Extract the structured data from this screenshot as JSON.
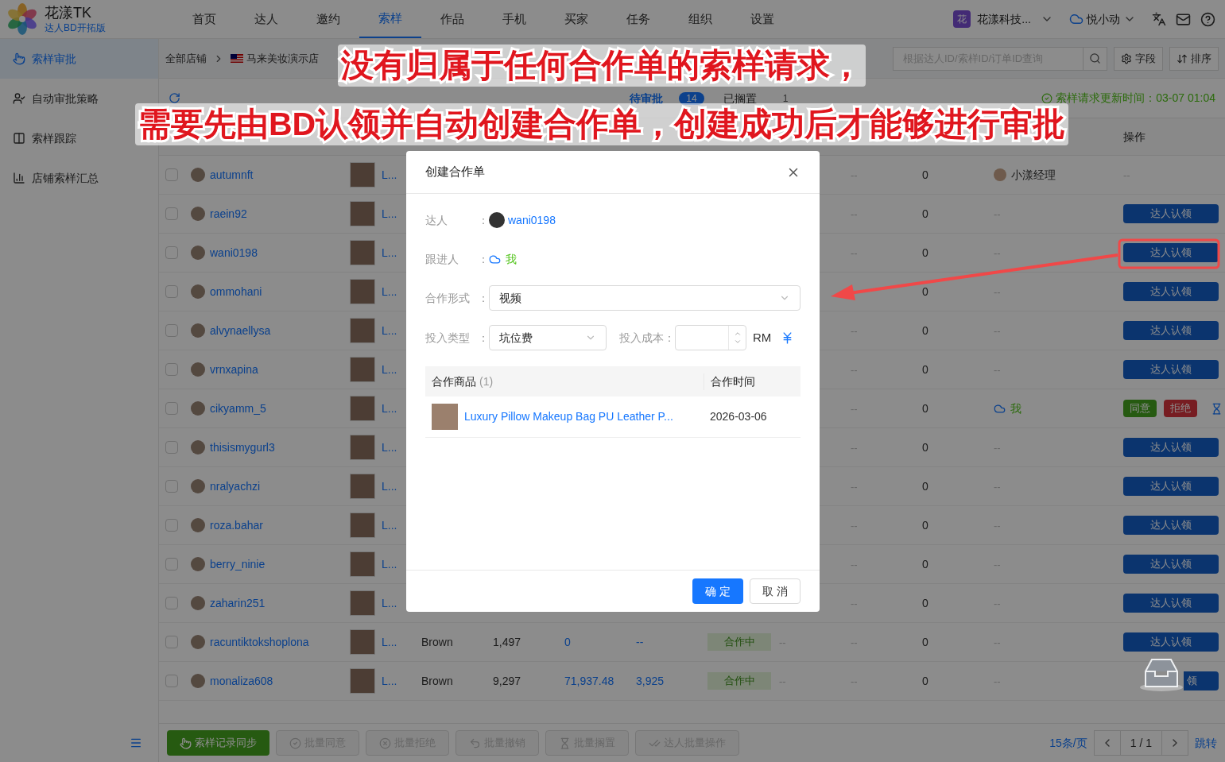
{
  "app": {
    "name": "花漾TK",
    "edition": "达人BD开拓版"
  },
  "nav": [
    {
      "label": "首页",
      "selected": false
    },
    {
      "label": "达人",
      "selected": false
    },
    {
      "label": "邀约",
      "selected": false
    },
    {
      "label": "索样",
      "selected": true
    },
    {
      "label": "作品",
      "selected": false
    },
    {
      "label": "手机",
      "selected": false
    },
    {
      "label": "买家",
      "selected": false
    },
    {
      "label": "任务",
      "selected": false
    },
    {
      "label": "组织",
      "selected": false
    },
    {
      "label": "设置",
      "selected": false
    }
  ],
  "account": {
    "org_badge": "花",
    "org": "花漾科技...",
    "user": "悦小动"
  },
  "sidebar": [
    {
      "label": "索样审批",
      "selected": true,
      "kind": "hand"
    },
    {
      "label": "自动审批策略",
      "selected": false,
      "kind": "person"
    },
    {
      "label": "索样跟踪",
      "selected": false,
      "kind": "board"
    },
    {
      "label": "店铺索样汇总",
      "selected": false,
      "kind": "chart"
    }
  ],
  "breadcrumb": {
    "root": "全部店铺",
    "store": "马来美妆演示店"
  },
  "search": {
    "placeholder": "根据达人ID/索样ID/订单ID查询"
  },
  "toolbar": [
    {
      "kind": "fields",
      "label": "字段"
    },
    {
      "kind": "sort",
      "label": "排序"
    }
  ],
  "tabs": [
    {
      "label": "待审批",
      "count": "14",
      "selected": true
    },
    {
      "label": "已搁置",
      "count": "1",
      "selected": false
    }
  ],
  "updated": "索样请求更新时间：03-07 01:04",
  "table": {
    "action_header": "操作",
    "rows": [
      {
        "checked": false,
        "creator": "autumnft",
        "product": "L...",
        "col_a": "--",
        "col_b": "0",
        "follower": {
          "kind": "user",
          "text": "小漾经理"
        },
        "action": {
          "kind": "none",
          "text": "--"
        }
      },
      {
        "checked": false,
        "creator": "raein92",
        "product": "L...",
        "col_a": "--",
        "col_b": "0",
        "follower": {
          "kind": "none",
          "text": "--"
        },
        "action": {
          "kind": "claim",
          "text": "达人认领"
        }
      },
      {
        "checked": false,
        "creator": "wani0198",
        "product": "L...",
        "col_a": "--",
        "col_b": "0",
        "follower": {
          "kind": "none",
          "text": "--"
        },
        "action": {
          "kind": "claim",
          "text": "达人认领"
        }
      },
      {
        "checked": false,
        "creator": "ommohani",
        "product": "L...",
        "col_b": "0",
        "follower": {
          "kind": "none",
          "text": "--"
        },
        "action": {
          "kind": "claim",
          "text": "达人认领"
        }
      },
      {
        "checked": false,
        "creator": "alvynaellysa",
        "product": "L...",
        "col_a": "--",
        "col_b": "0",
        "follower": {
          "kind": "none",
          "text": "--"
        },
        "action": {
          "kind": "claim",
          "text": "达人认领"
        }
      },
      {
        "checked": false,
        "creator": "vrnxapina",
        "product": "L...",
        "col_a": "--",
        "col_b": "0",
        "follower": {
          "kind": "none",
          "text": "--"
        },
        "action": {
          "kind": "claim",
          "text": "达人认领"
        }
      },
      {
        "checked": false,
        "creator": "cikyamm_5",
        "product": "L...",
        "col_a": "--",
        "col_b": "0",
        "follower": {
          "kind": "self",
          "text": "我"
        },
        "action": {
          "kind": "decide",
          "agree": "同意",
          "reject": "拒绝"
        }
      },
      {
        "checked": false,
        "creator": "thisismygurl3",
        "product": "L...",
        "col_a": "--",
        "col_b": "0",
        "follower": {
          "kind": "none",
          "text": "--"
        },
        "action": {
          "kind": "claim",
          "text": "达人认领"
        }
      },
      {
        "checked": false,
        "creator": "nralyachzi",
        "product": "L...",
        "col_a": "--",
        "col_b": "0",
        "follower": {
          "kind": "none",
          "text": "--"
        },
        "action": {
          "kind": "claim",
          "text": "达人认领"
        }
      },
      {
        "checked": false,
        "creator": "roza.bahar",
        "product": "L...",
        "col_a": "--",
        "col_b": "0",
        "follower": {
          "kind": "none",
          "text": "--"
        },
        "action": {
          "kind": "claim",
          "text": "达人认领"
        }
      },
      {
        "checked": false,
        "creator": "berry_ninie",
        "product": "L...",
        "col_a": "--",
        "col_b": "0",
        "follower": {
          "kind": "none",
          "text": "--"
        },
        "action": {
          "kind": "claim",
          "text": "达人认领"
        }
      },
      {
        "checked": false,
        "creator": "zaharin251",
        "product": "L...",
        "col_a": "--",
        "col_b": "0",
        "follower": {
          "kind": "none",
          "text": "--"
        },
        "action": {
          "kind": "claim",
          "text": "达人认领"
        }
      },
      {
        "checked": false,
        "creator": "racuntiktokshoplona",
        "product": "L...",
        "sku": "Brown",
        "c1": "1,497",
        "c2": "0",
        "c3": "--",
        "status": "合作中",
        "c4": "--",
        "col_a": "--",
        "col_b": "0",
        "follower": {
          "kind": "none",
          "text": "--"
        },
        "action": {
          "kind": "claim",
          "text": "达人认领"
        }
      },
      {
        "checked": false,
        "creator": "monaliza608",
        "product": "L...",
        "sku": "Brown",
        "c1": "9,297",
        "c2": "71,937.48",
        "c3": "3,925",
        "status": "合作中",
        "c4": "--",
        "col_a": "--",
        "col_b": "0",
        "follower": {
          "kind": "none",
          "text": "--"
        },
        "action": {
          "kind": "claim_covered",
          "text": "领"
        }
      }
    ]
  },
  "footer": {
    "buttons": [
      {
        "kind": "sync",
        "label": "索样记录同步",
        "disabled": false
      },
      {
        "kind": "agree",
        "label": "批量同意",
        "disabled": true
      },
      {
        "kind": "reject",
        "label": "批量拒绝",
        "disabled": true
      },
      {
        "kind": "undo",
        "label": "批量撤销",
        "disabled": true
      },
      {
        "kind": "shelve",
        "label": "批量搁置",
        "disabled": true
      },
      {
        "kind": "creator",
        "label": "达人批量操作",
        "disabled": true
      }
    ],
    "page_size": "15条/页",
    "page": "1 / 1",
    "jump": "跳转"
  },
  "dialog": {
    "title": "创建合作单",
    "colon": "：",
    "creator_label": "达人",
    "creator": "wani0198",
    "follower_label": "跟进人",
    "follower": "我",
    "form_label": "合作形式",
    "form_value": "视频",
    "type_label": "投入类型",
    "type_value": "坑位费",
    "cost_label": "投入成本：",
    "currency": "RM",
    "products_header": "合作商品",
    "products_count": "(1)",
    "time_header": "合作时间",
    "products": [
      {
        "name": "Luxury Pillow Makeup Bag PU Leather P...",
        "date": "2026-03-06"
      }
    ],
    "confirm": "确 定",
    "cancel": "取 消"
  },
  "annotation": {
    "lines": [
      "没有归属于任何合作单的索样请求，",
      "需要先由BD认领并自动创建合作单，创建成功后才能够进行审批"
    ]
  }
}
